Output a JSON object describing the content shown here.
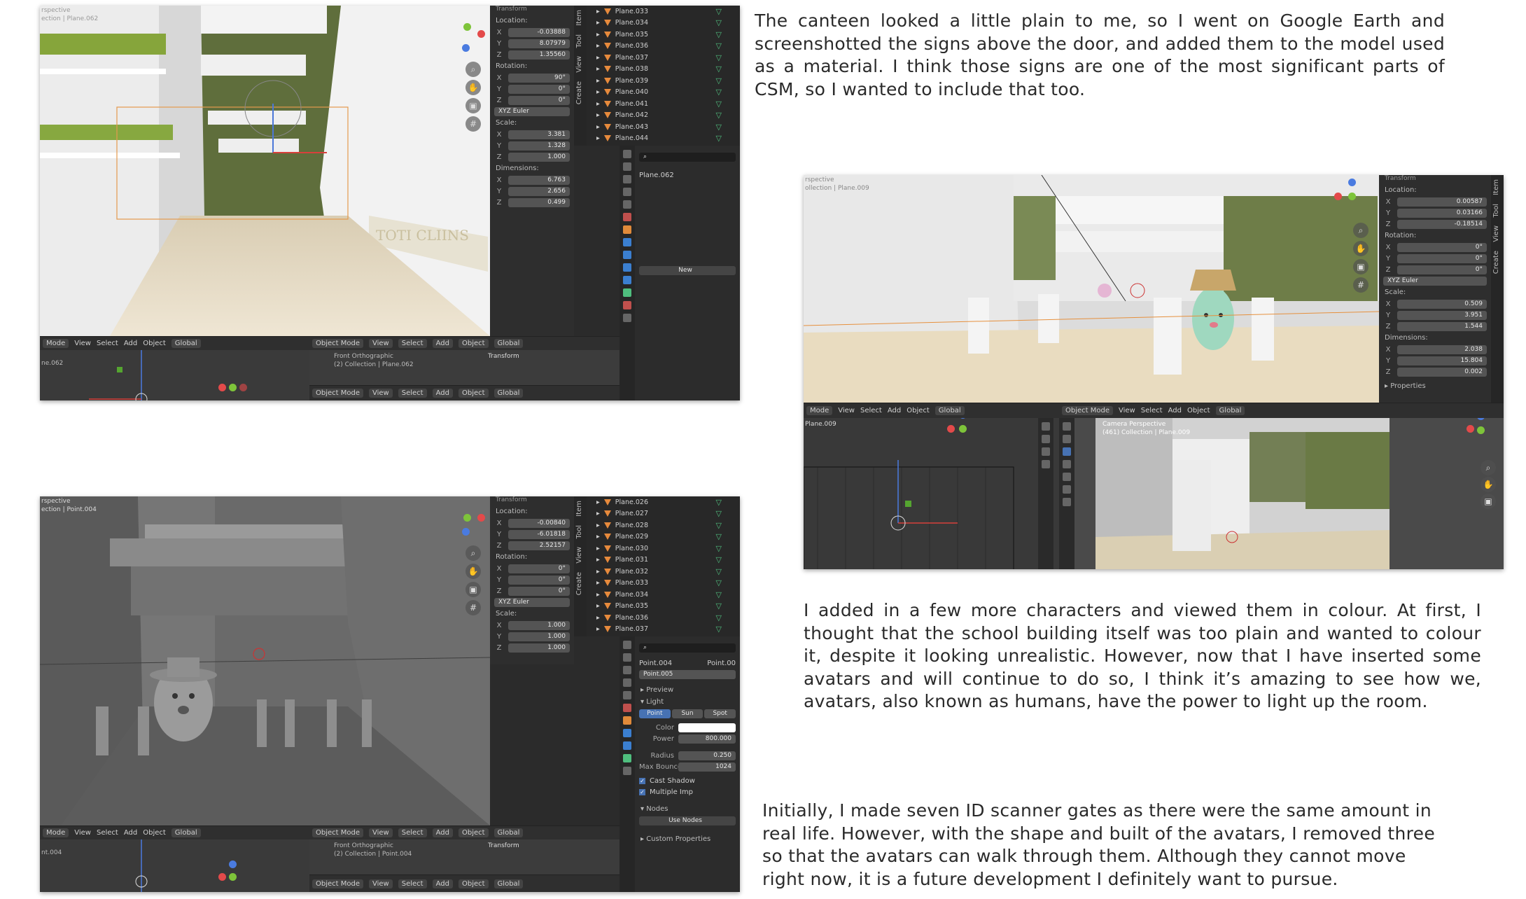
{
  "paragraphs": {
    "p1": "The canteen looked a little plain to me, so I went on Google Earth and screenshotted the signs above the door, and added them to the model used as a material. I think those signs are one of the most significant parts of CSM, so I wanted to include that too.",
    "p2": "I added in a few more characters and viewed them in colour. At first, I thought that the school building itself was too plain and wanted to colour it, despite it looking unrealistic. However, now that I have inserted some avatars and will continue to do so, I think it’s amazing to see how we, avatars, also known as humans, have the power to light up the room.",
    "p3": "Initially, I made seven ID scanner gates as there were the same amount in real life. However, with the shape and built of the avatars, I removed three so that the avatars can walk through them. Although they cannot move right now, it is a future development I definitely want to pursue."
  },
  "ui": {
    "menus": [
      "Mode",
      "View",
      "Select",
      "Add",
      "Object"
    ],
    "global": "Global",
    "object_mode": "Object Mode",
    "transform": "Transform",
    "location": "Location:",
    "rotation": "Rotation:",
    "scale": "Scale:",
    "dimensions": "Dimensions:",
    "euler": "XYZ Euler",
    "tabs": [
      "Item",
      "Tool",
      "View",
      "Create"
    ],
    "front_ortho": "Front Orthographic",
    "camera_persp": "Camera Perspective",
    "user_persp": "rspective",
    "new": "New",
    "properties": "Properties"
  },
  "s1": {
    "coll_label": "ection | Plane.062",
    "bottom_obj": "ne.062",
    "collection": "(2) Collection | Plane.062",
    "loc": [
      "-0.03888",
      "8.07979",
      "1.35560"
    ],
    "rot": [
      "90°",
      "0°",
      "0°"
    ],
    "scl": [
      "3.381",
      "1.328",
      "1.000"
    ],
    "dim": [
      "6.763",
      "2.656",
      "0.499"
    ],
    "outliner": [
      "Plane.033",
      "Plane.034",
      "Plane.035",
      "Plane.036",
      "Plane.037",
      "Plane.038",
      "Plane.039",
      "Plane.040",
      "Plane.041",
      "Plane.042",
      "Plane.043",
      "Plane.044"
    ],
    "material_slot": "Plane.062"
  },
  "s2": {
    "coll_label": "ection | Point.004",
    "bottom_obj": "nt.004",
    "collection": "(2) Collection | Point.004",
    "loc": [
      "-0.00840",
      "-6.01818",
      "2.52157"
    ],
    "rot": [
      "0°",
      "0°",
      "0°"
    ],
    "scl": [
      "1.000",
      "1.000",
      "1.000"
    ],
    "outliner": [
      "Plane.026",
      "Plane.027",
      "Plane.028",
      "Plane.029",
      "Plane.030",
      "Plane.031",
      "Plane.032",
      "Plane.033",
      "Plane.034",
      "Plane.035",
      "Plane.036",
      "Plane.037"
    ],
    "light_obj": "Point.004",
    "light_obj2": "Point.00",
    "light_data": "Point.005",
    "preview": "Preview",
    "light": "Light",
    "types": [
      "Point",
      "Sun",
      "Spot"
    ],
    "color_lbl": "Color",
    "power_lbl": "Power",
    "power": "800.000",
    "radius_lbl": "Radius",
    "radius": "0.250",
    "bounces_lbl": "Max Bounces",
    "bounces": "1024",
    "cast_shadow": "Cast Shadow",
    "multiple": "Multiple Imp",
    "nodes": "Nodes",
    "use_nodes": "Use Nodes",
    "custom_props": "Custom Properties"
  },
  "s3": {
    "coll_label": "ollection | Plane.009",
    "bottom_obj": "Plane.009",
    "collection": "(461) Collection | Plane.009",
    "loc": [
      "0.00587",
      "0.03166",
      "-0.18514"
    ],
    "rot": [
      "0°",
      "0°",
      "0°"
    ],
    "scl": [
      "0.509",
      "3.951",
      "1.544"
    ],
    "dim": [
      "2.038",
      "15.804",
      "0.002"
    ],
    "menus2": [
      "Object Mode",
      "View",
      "Select",
      "Add",
      "Object",
      "Global"
    ]
  }
}
